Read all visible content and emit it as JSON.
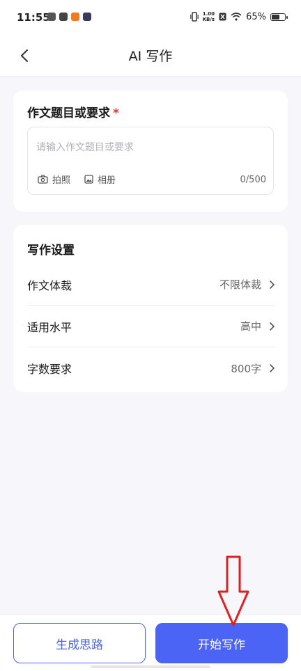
{
  "status_bar": {
    "time": "11:55",
    "speed_top": "1.00",
    "speed_bottom": "KB/s",
    "battery_text": "65%",
    "battery_level": 0.65
  },
  "nav": {
    "title": "AI 写作"
  },
  "topic_card": {
    "heading": "作文题目或要求",
    "required_mark": "*",
    "placeholder": "请输入作文题目或要求",
    "value": "",
    "camera_label": "拍照",
    "album_label": "相册",
    "counter": "0/500"
  },
  "settings_card": {
    "heading": "写作设置",
    "rows": [
      {
        "label": "作文体裁",
        "value": "不限体裁"
      },
      {
        "label": "适用水平",
        "value": "高中"
      },
      {
        "label": "字数要求",
        "value": "800字"
      }
    ]
  },
  "bottom": {
    "outline_button": "生成思路",
    "primary_button": "开始写作"
  },
  "colors": {
    "accent": "#4b64f5",
    "required": "#e0382f",
    "annotation": "#e02020"
  }
}
